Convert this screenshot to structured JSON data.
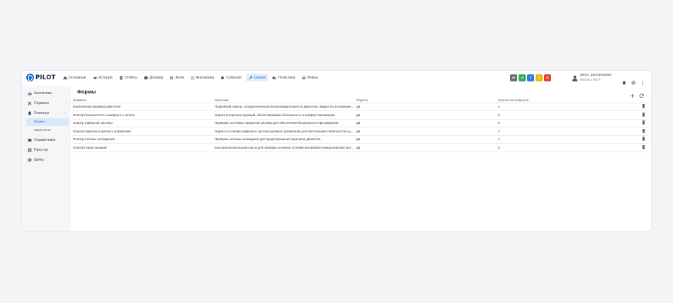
{
  "brand": {
    "name": "PILOT"
  },
  "nav": [
    {
      "label": "Основные",
      "icon": "home-icon"
    },
    {
      "label": "История",
      "icon": "history-icon"
    },
    {
      "label": "Отчёты",
      "icon": "report-icon"
    },
    {
      "label": "Договор",
      "icon": "contract-icon"
    },
    {
      "label": "Атом",
      "icon": "atom-icon"
    },
    {
      "label": "Аналитика",
      "icon": "analytics-icon"
    },
    {
      "label": "События",
      "icon": "bell-icon"
    },
    {
      "label": "Сервис",
      "icon": "wrench-icon",
      "active": true
    },
    {
      "label": "Логистика",
      "icon": "truck-icon"
    },
    {
      "label": "Рейсы",
      "icon": "bus-icon"
    }
  ],
  "badges": [
    {
      "label": "99",
      "color": "#6b6f76"
    },
    {
      "label": "10",
      "color": "#22b14c"
    },
    {
      "label": "6",
      "color": "#2d7be5"
    },
    {
      "label": "0",
      "color": "#f2b90c"
    },
    {
      "label": "47",
      "color": "#e8413c"
    }
  ],
  "user": {
    "name": "demo_demo(master)",
    "sub": "9602641785 P"
  },
  "sidebar": {
    "items": [
      {
        "label": "Аналитика",
        "icon": "chart-icon"
      },
      {
        "label": "Сервисы",
        "icon": "tools-icon",
        "chevron": "›"
      },
      {
        "label": "Осмотры",
        "icon": "clipboard-icon",
        "chevron": "⌄"
      },
      {
        "label": "Справочники",
        "icon": "book-icon",
        "chevron": "›"
      },
      {
        "label": "Простои",
        "icon": "grid-icon"
      },
      {
        "label": "Шины",
        "icon": "tire-icon"
      }
    ],
    "sub": [
      {
        "label": "Формы",
        "active": true
      },
      {
        "label": "Законченo"
      }
    ]
  },
  "page": {
    "title": "Формы"
  },
  "table": {
    "columns": [
      "Название",
      "Описание",
      "Подпись",
      "Количество вопросов"
    ],
    "rows": [
      [
        "Комплексная проверка двигателя",
        "Подробный осмотр, сосредоточенный на производительности двигателя, жидкостях и компонентах",
        "Да",
        "4"
      ],
      [
        "Осмотр безопасности и комфорта в салоне",
        "Оценка внутренних функций, обеспечивающих безопасность и комфорт пассажиров.",
        "Да",
        "5"
      ],
      [
        "Осмотр тормозной системы",
        "Проверка состояния тормозной системы для обеспечения безопасности при вождении.",
        "Да",
        "5"
      ],
      [
        "Осмотр подвески и рулевого управления",
        "Оценка состояния подвески и системы рулевого управления для обеспечения стабильности и управляемости",
        "Да",
        "4"
      ],
      [
        "Осмотр системы охлаждения",
        "Проверка системы охлаждения для предотвращения перегрева двигателя.",
        "Да",
        "4"
      ],
      [
        "Осмотр перед поездкой",
        "Быстрый контрольный список для проверки основных условий автомобиля перед началом поездки",
        "Да",
        "5"
      ]
    ]
  }
}
